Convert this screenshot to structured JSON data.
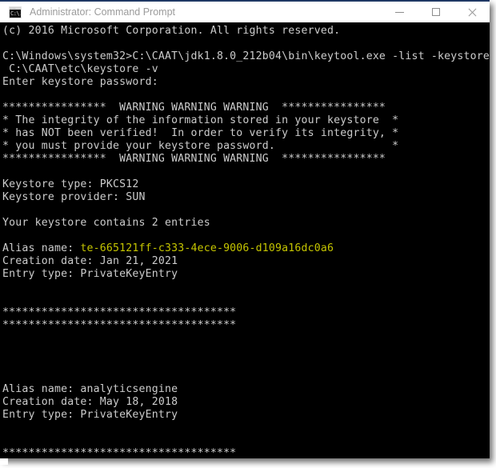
{
  "window": {
    "title": "Administrator: Command Prompt",
    "icon": "command-prompt-icon",
    "icon_prompt_text": "C:\\.",
    "controls": {
      "minimize": "minimize-icon",
      "maximize": "maximize-icon",
      "close": "close-icon"
    }
  },
  "colors": {
    "console_bg": "#000000",
    "console_fg": "#cccccc",
    "highlight_fg": "#c5c500",
    "titlebar_bg": "#ffffff",
    "titlebar_fg": "#9b9b9b",
    "titlebar_accent": "#1f3864"
  },
  "console": {
    "lines": [
      {
        "text": "(c) 2016 Microsoft Corporation. All rights reserved."
      },
      {
        "text": ""
      },
      {
        "text": "C:\\Windows\\system32>C:\\CAAT\\jdk1.8.0_212b04\\bin\\keytool.exe -list -keystore"
      },
      {
        "text": " C:\\CAAT\\etc\\keystore -v"
      },
      {
        "text": "Enter keystore password:"
      },
      {
        "text": ""
      },
      {
        "text": "****************  WARNING WARNING WARNING  ****************"
      },
      {
        "text": "* The integrity of the information stored in your keystore  *"
      },
      {
        "text": "* has NOT been verified!  In order to verify its integrity, *"
      },
      {
        "text": "* you must provide your keystore password.                  *"
      },
      {
        "text": "****************  WARNING WARNING WARNING  ****************"
      },
      {
        "text": ""
      },
      {
        "text": "Keystore type: PKCS12"
      },
      {
        "text": "Keystore provider: SUN"
      },
      {
        "text": ""
      },
      {
        "text": "Your keystore contains 2 entries"
      },
      {
        "text": ""
      },
      {
        "prefix": "Alias name: ",
        "highlight": "te-665121ff-c333-4ece-9006-d109a16dc0a6"
      },
      {
        "text": "Creation date: Jan 21, 2021"
      },
      {
        "text": "Entry type: PrivateKeyEntry"
      },
      {
        "text": ""
      },
      {
        "text": ""
      },
      {
        "text": "************************************"
      },
      {
        "text": "************************************"
      },
      {
        "text": ""
      },
      {
        "text": ""
      },
      {
        "text": ""
      },
      {
        "text": ""
      },
      {
        "text": "Alias name: analyticsengine"
      },
      {
        "text": "Creation date: May 18, 2018"
      },
      {
        "text": "Entry type: PrivateKeyEntry"
      },
      {
        "text": ""
      },
      {
        "text": ""
      },
      {
        "text": "************************************"
      },
      {
        "text": "************************************"
      }
    ]
  }
}
